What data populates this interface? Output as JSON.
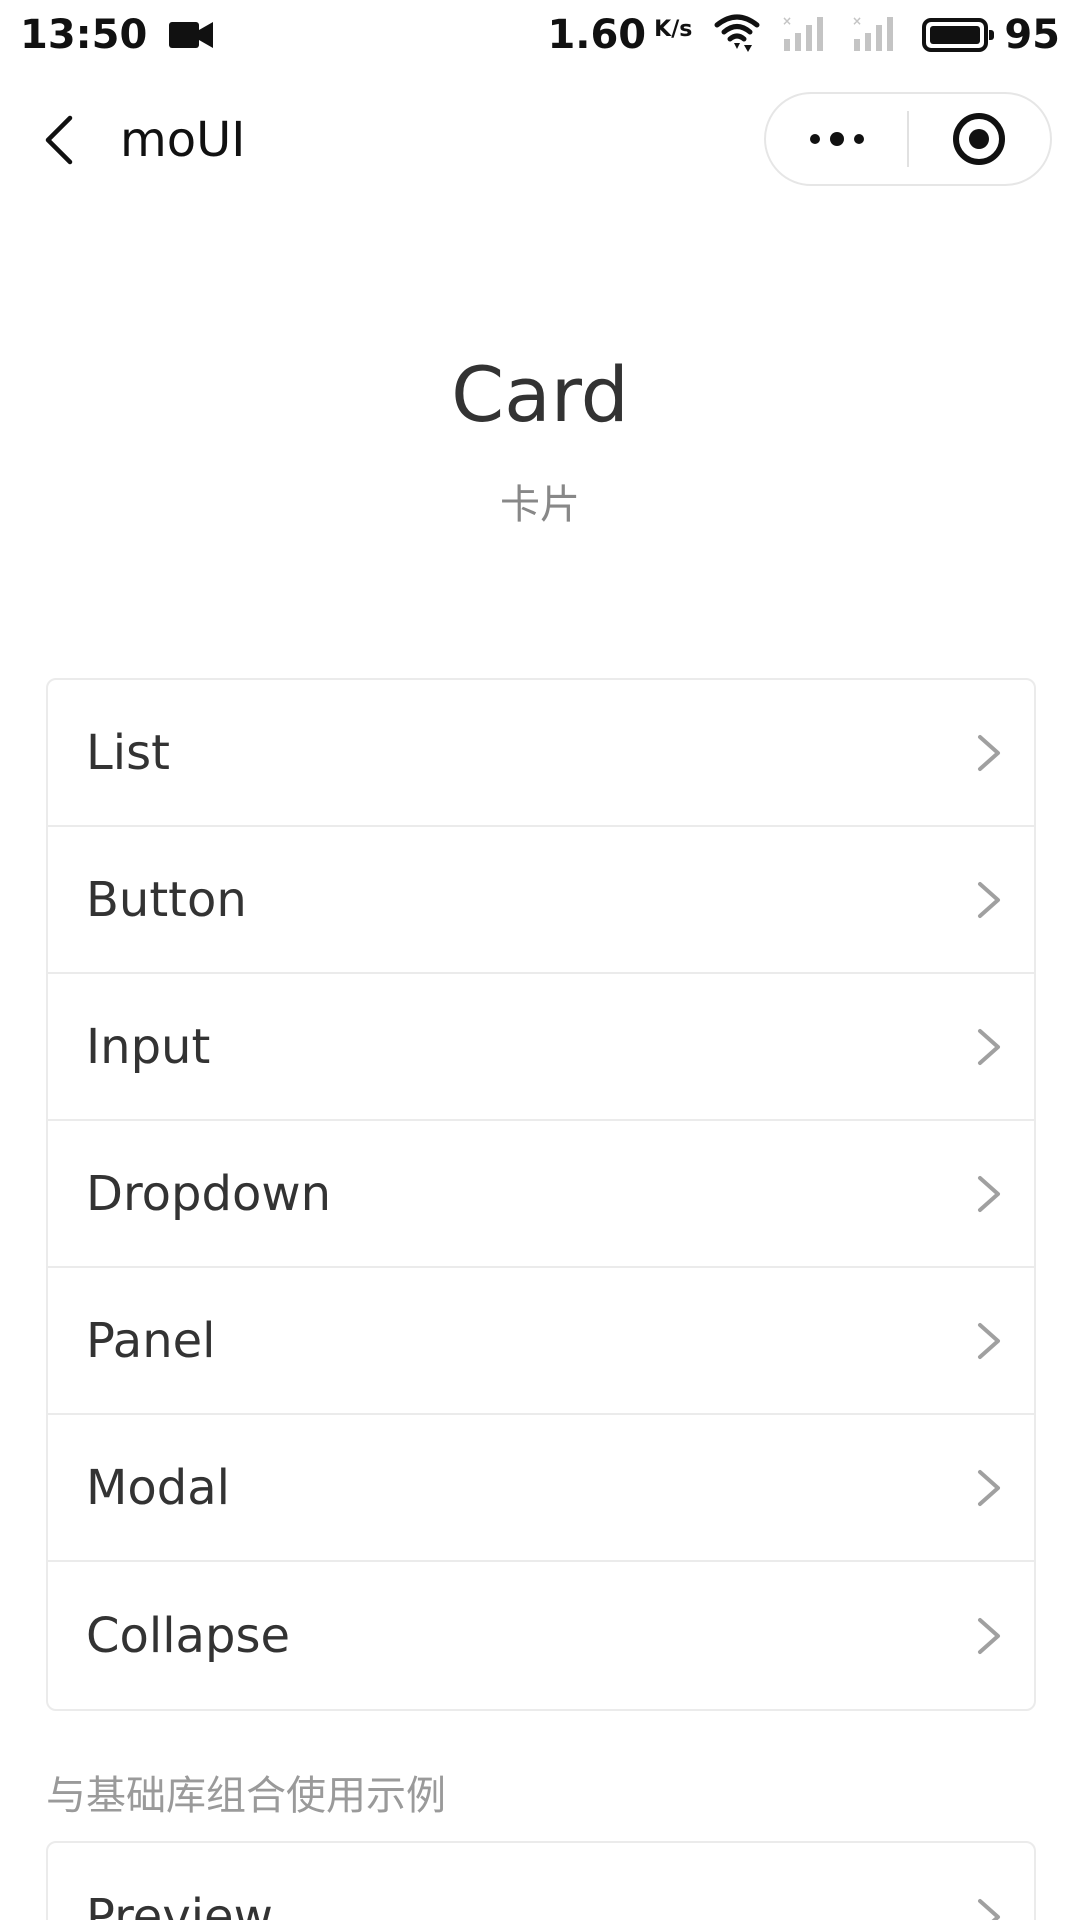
{
  "status_bar": {
    "time": "13:50",
    "speed": "1.60",
    "speed_unit": "K/s",
    "battery_level": "95",
    "icons": [
      "video-camera-icon",
      "wifi-icon",
      "signal-icon",
      "signal-icon",
      "battery-icon"
    ]
  },
  "nav": {
    "title": "moUI",
    "back_icon": "chevron-left-icon",
    "more_icon": "more-dots-icon",
    "close_icon": "target-circle-icon"
  },
  "header": {
    "title": "Card",
    "subtitle": "卡片"
  },
  "menu": {
    "items": [
      {
        "label": "List"
      },
      {
        "label": "Button"
      },
      {
        "label": "Input"
      },
      {
        "label": "Dropdown"
      },
      {
        "label": "Panel"
      },
      {
        "label": "Modal"
      },
      {
        "label": "Collapse"
      }
    ],
    "arrow_icon": "chevron-right-icon"
  },
  "section": {
    "label": "与基础库组合使用示例",
    "items": [
      {
        "label": "Preview"
      }
    ]
  },
  "colors": {
    "text": "#333333",
    "muted": "#888888",
    "border": "#ebebeb",
    "arrow": "#a0a0a0"
  }
}
